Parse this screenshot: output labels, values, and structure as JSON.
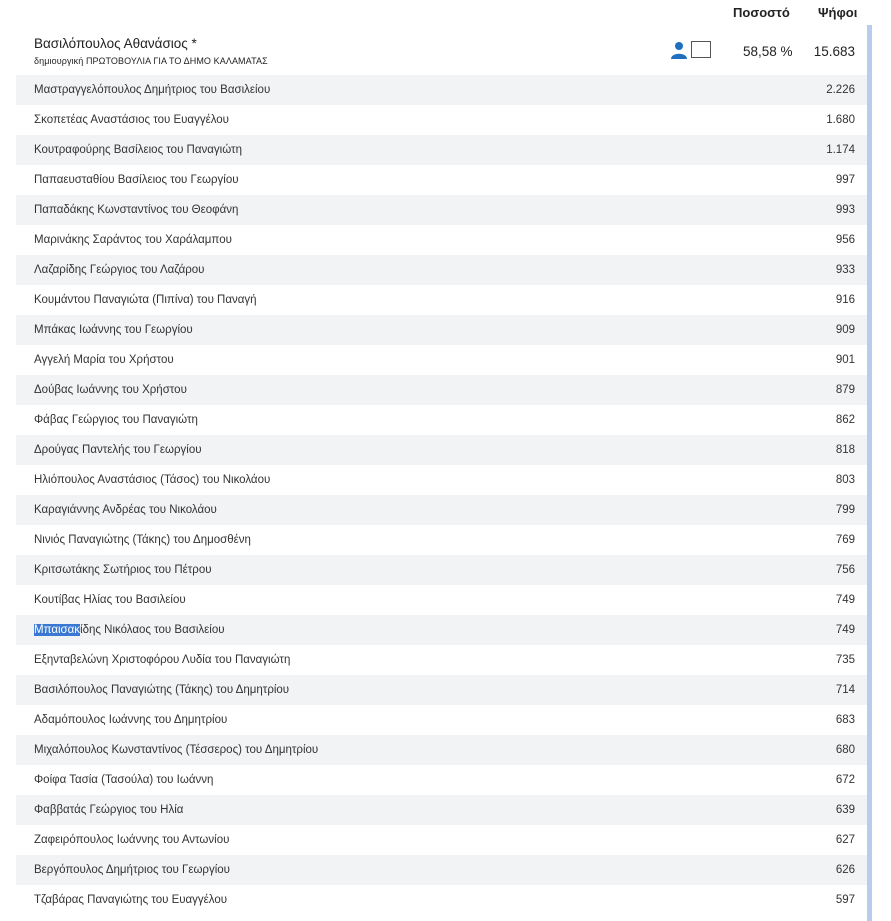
{
  "header": {
    "pct_label": "Ποσοστό",
    "votes_label": "Ψήφοι"
  },
  "leader": {
    "name": "Βασιλόπουλος Αθανάσιος *",
    "party": "δημιουργική ΠΡΩΤΟΒΟΥΛΙΑ ΓΙΑ ΤΟ ΔΗΜΟ ΚΑΛΑΜΑΤΑΣ",
    "pct": "58,58 %",
    "votes": "15.683",
    "icon": "person-icon"
  },
  "candidates": [
    {
      "name": "Μαστραγγελόπουλος Δημήτριος του Βασιλείου",
      "votes": "2.226"
    },
    {
      "name": "Σκοπετέας Αναστάσιος του Ευαγγέλου",
      "votes": "1.680"
    },
    {
      "name": "Κουτραφούρης Βασίλειος του Παναγιώτη",
      "votes": "1.174"
    },
    {
      "name": "Παπαευσταθίου Βασίλειος του Γεωργίου",
      "votes": "997"
    },
    {
      "name": "Παπαδάκης Κωνσταντίνος του Θεοφάνη",
      "votes": "993"
    },
    {
      "name": "Μαρινάκης Σαράντος του Χαράλαμπου",
      "votes": "956"
    },
    {
      "name": "Λαζαρίδης Γεώργιος του Λαζάρου",
      "votes": "933"
    },
    {
      "name": "Κουμάντου Παναγιώτα (Πιπίνα) του Παναγή",
      "votes": "916"
    },
    {
      "name": "Μπάκας Ιωάννης του Γεωργίου",
      "votes": "909"
    },
    {
      "name": "Αγγελή Μαρία του Χρήστου",
      "votes": "901"
    },
    {
      "name": "Δούβας Ιωάννης του Χρήστου",
      "votes": "879"
    },
    {
      "name": "Φάβας Γεώργιος του Παναγιώτη",
      "votes": "862"
    },
    {
      "name": "Δρούγας Παντελής του Γεωργίου",
      "votes": "818"
    },
    {
      "name": "Ηλιόπουλος Αναστάσιος (Τάσος) του Νικολάου",
      "votes": "803"
    },
    {
      "name": "Καραγιάννης Ανδρέας του Νικολάου",
      "votes": "799"
    },
    {
      "name": "Νινιός Παναγιώτης (Τάκης) του Δημοσθένη",
      "votes": "769"
    },
    {
      "name": "Κριτσωτάκης Σωτήριος του Πέτρου",
      "votes": "756"
    },
    {
      "name": "Κουτίβας Ηλίας του Βασιλείου",
      "votes": "749"
    },
    {
      "name": "Μπαισακίδης Νικόλαος του Βασιλείου",
      "votes": "749",
      "selected_text": "Μπαισακ",
      "rest_text": "ίδης Νικόλαος του Βασιλείου"
    },
    {
      "name": "Εξηνταβελώνη Χριστοφόρου Λυδία του Παναγιώτη",
      "votes": "735"
    },
    {
      "name": "Βασιλόπουλος Παναγιώτης (Τάκης) του Δημητρίου",
      "votes": "714"
    },
    {
      "name": "Αδαμόπουλος Ιωάννης του Δημητρίου",
      "votes": "683"
    },
    {
      "name": "Μιχαλόπουλος Κωνσταντίνος (Τέσσερος) του Δημητρίου",
      "votes": "680"
    },
    {
      "name": "Φοίφα Τασία (Τασούλα) του Ιωάννη",
      "votes": "672"
    },
    {
      "name": "Φαββατάς Γεώργιος του Ηλία",
      "votes": "639"
    },
    {
      "name": "Ζαφειρόπουλος Ιωάννης του Αντωνίου",
      "votes": "627"
    },
    {
      "name": "Βεργόπουλος Δημήτριος του Γεωργίου",
      "votes": "626"
    },
    {
      "name": "Τζαβάρας Παναγιώτης του Ευαγγέλου",
      "votes": "597"
    }
  ],
  "colors": {
    "accent": "#1f6fbf",
    "selection": "#3a78d4",
    "row_alt": "#f2f3f5",
    "scrollbar": "#b8ccec"
  }
}
